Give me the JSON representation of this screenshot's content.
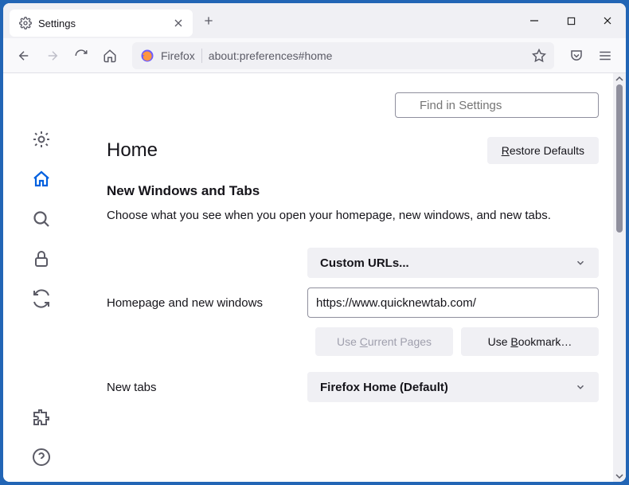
{
  "tab": {
    "title": "Settings"
  },
  "urlbar": {
    "identity": "Firefox",
    "url": "about:preferences#home"
  },
  "search": {
    "placeholder": "Find in Settings"
  },
  "page": {
    "title": "Home",
    "restore": "Restore Defaults",
    "section_title": "New Windows and Tabs",
    "section_desc": "Choose what you see when you open your homepage, new windows, and new tabs.",
    "homepage_label": "Homepage and new windows",
    "homepage_select": "Custom URLs...",
    "homepage_value": "https://www.quicknewtab.com/",
    "use_current": "Use Current Pages",
    "use_bookmark": "Use Bookmark…",
    "newtabs_label": "New tabs",
    "newtabs_select": "Firefox Home (Default)"
  }
}
